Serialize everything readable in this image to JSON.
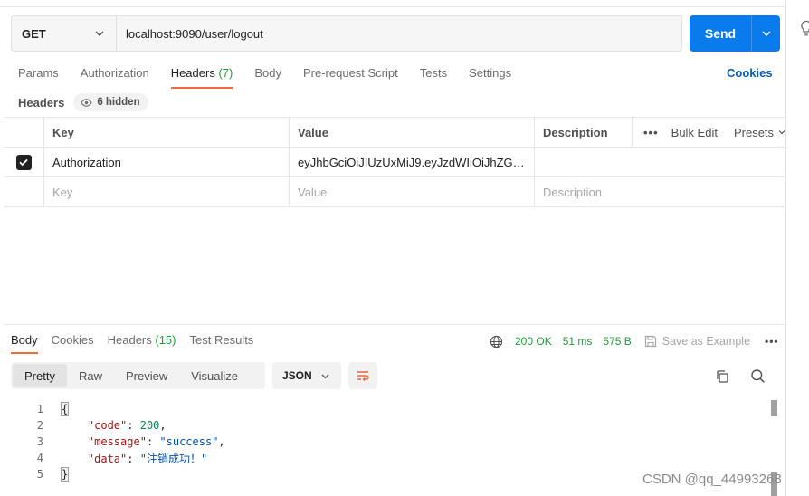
{
  "request": {
    "method": "GET",
    "url": "localhost:9090/user/logout",
    "send_label": "Send"
  },
  "tabs": [
    {
      "label": "Params"
    },
    {
      "label": "Authorization"
    },
    {
      "label": "Headers",
      "count": "(7)",
      "active": true
    },
    {
      "label": "Body"
    },
    {
      "label": "Pre-request Script"
    },
    {
      "label": "Tests"
    },
    {
      "label": "Settings"
    }
  ],
  "cookies_label": "Cookies",
  "headers_section": {
    "label": "Headers",
    "hidden_count": "6 hidden",
    "columns": {
      "key": "Key",
      "value": "Value",
      "description": "Description"
    },
    "bulk_edit": "Bulk Edit",
    "presets": "Presets",
    "rows": [
      {
        "checked": true,
        "key": "Authorization",
        "value": "eyJhbGciOiJIUzUxMiJ9.eyJzdWIiOiJhZG1pb…",
        "description": ""
      }
    ],
    "placeholder": {
      "key": "Key",
      "value": "Value",
      "description": "Description"
    }
  },
  "response": {
    "tabs": [
      {
        "label": "Body",
        "active": true
      },
      {
        "label": "Cookies"
      },
      {
        "label": "Headers",
        "count": "(15)"
      },
      {
        "label": "Test Results"
      }
    ],
    "status": "200 OK",
    "time": "51 ms",
    "size": "575 B",
    "save_example": "Save as Example",
    "views": [
      "Pretty",
      "Raw",
      "Preview",
      "Visualize"
    ],
    "active_view": "Pretty",
    "format": "JSON",
    "body_lines": [
      {
        "n": "1",
        "text": "{"
      },
      {
        "n": "2",
        "key": "\"code\"",
        "sep": ": ",
        "num": "200",
        "tail": ","
      },
      {
        "n": "3",
        "key": "\"message\"",
        "sep": ": ",
        "str": "\"success\"",
        "tail": ","
      },
      {
        "n": "4",
        "key": "\"data\"",
        "sep": ": ",
        "str": "\"注销成功！\"",
        "tail": ""
      },
      {
        "n": "5",
        "text": "}"
      }
    ]
  },
  "watermark": "CSDN @qq_44993268"
}
